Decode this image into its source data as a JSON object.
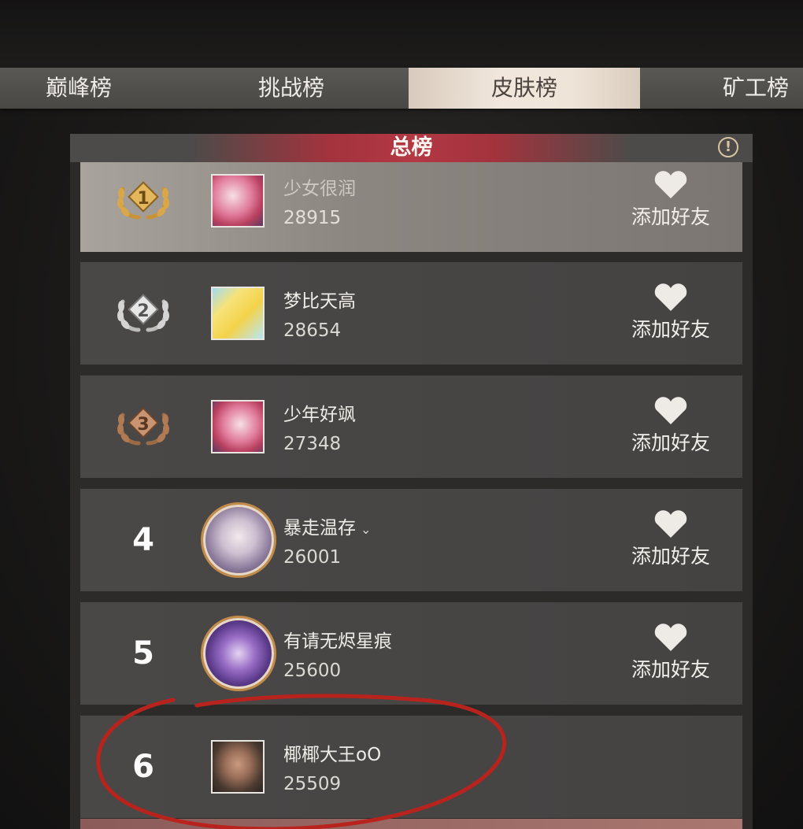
{
  "tabs": [
    {
      "label": "巅峰榜",
      "active": false
    },
    {
      "label": "挑战榜",
      "active": false
    },
    {
      "label": "皮肤榜",
      "active": true
    },
    {
      "label": "矿工榜",
      "active": false
    }
  ],
  "section_title": "总榜",
  "info_icon": "info-icon",
  "add_friend_label": "添加好友",
  "ranking": [
    {
      "rank": "1",
      "name": "少女很润",
      "score": "28915",
      "badge": "gold-laurel",
      "avatar": "pink-flower-square"
    },
    {
      "rank": "2",
      "name": "梦比天高",
      "score": "28654",
      "badge": "silver-laurel",
      "avatar": "yellow-chick-square"
    },
    {
      "rank": "3",
      "name": "少年好飒",
      "score": "27348",
      "badge": "bronze-laurel",
      "avatar": "pink-flower-square"
    },
    {
      "rank": "4",
      "name": "暴走温存",
      "score": "26001",
      "avatar": "portrait-round"
    },
    {
      "rank": "5",
      "name": "有请无烬星痕",
      "score": "25600",
      "avatar": "purple-dragon-round"
    },
    {
      "rank": "6",
      "name": "椰椰大王oO",
      "score": "25509",
      "avatar": "man-portrait-square"
    }
  ],
  "colors": {
    "accent_red": "#b23844",
    "gold": "#d9a64a",
    "silver": "#d4d4d4",
    "bronze": "#b07a52",
    "annotation_red": "#b8231d"
  }
}
